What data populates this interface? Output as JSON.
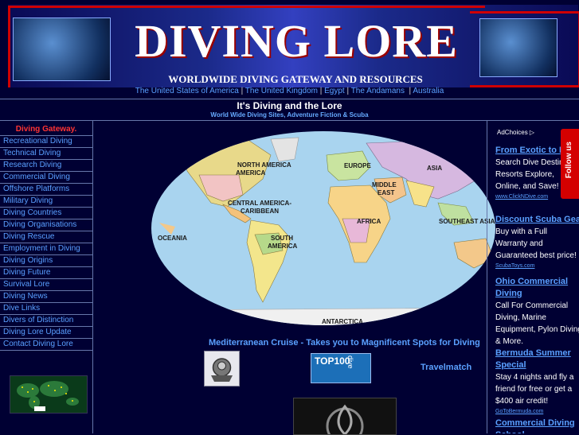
{
  "banner": {
    "logo_text": "DIVING LORE",
    "tagline": "WORLDWIDE DIVING GATEWAY AND RESOURCES"
  },
  "countries": [
    "The United States of America",
    "The United Kingdom",
    "Egypt",
    "The Andamans",
    "Australia"
  ],
  "header": {
    "title": "It's Diving and the Lore",
    "subtitle": "World Wide Diving Sites, Adventure Fiction & Scuba"
  },
  "sidebar": {
    "heading": "Diving Gateway.",
    "items": [
      "Recreational Diving",
      "Technical Diving",
      "Research Diving",
      "Commercial Diving",
      "Offshore Platforms",
      "Military Diving",
      "Diving Countries",
      "Diving Organisations",
      "Diving Rescue",
      "Employment in Diving",
      "Diving Origins",
      "Diving Future",
      "Survival Lore",
      "Diving News",
      "Dive Links",
      "Divers of Distinction",
      "Diving Lore Update",
      "Contact Diving Lore"
    ]
  },
  "map": {
    "regions": [
      "NORTH AMERICA",
      "EUROPE",
      "ASIA",
      "MIDDLE EAST",
      "CENTRAL AMERICA-CARIBBEAN",
      "AFRICA",
      "SOUTHEAST ASIA",
      "OCEANIA",
      "SOUTH AMERICA",
      "ANTARCTICA"
    ]
  },
  "main": {
    "cruise_link": "Mediterranean Cruise - Takes you to Magnificent Spots for Diving",
    "top100_text": "TOP100",
    "top100_sub": "dive",
    "travelmatch": "Travelmatch"
  },
  "ads": {
    "adchoices": "AdChoices",
    "follow_us": "Follow us",
    "items": [
      {
        "title": "From Exotic to Lo",
        "body": "Search Dive Destin & Resorts Explore, Online, and Save!",
        "url": "www.ClickNDive.com"
      },
      {
        "title": "Discount Scuba Gea",
        "body": "Buy with a Full Warranty and Guaranteed best price!",
        "url": "ScubaToys.com"
      },
      {
        "title": "Ohio Commercial Diving",
        "body": "Call For Commercial Diving, Marine Equipment, Pylon Diving & More.",
        "url": ""
      },
      {
        "title": "Bermuda Summer Special",
        "body": "Stay 4 nights and fly a friend for free or get a $400 air credit!",
        "url": "GoToBermuda.com"
      },
      {
        "title": "Commercial Diving School",
        "body": "",
        "url": ""
      }
    ]
  },
  "colors": {
    "background": "#000033",
    "link": "#5aa0ff",
    "accent_red": "#d00000"
  }
}
